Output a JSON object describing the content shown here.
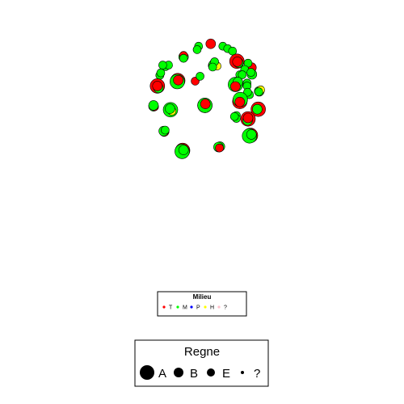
{
  "chart_data": {
    "type": "scatter",
    "title": "",
    "xlabel": "",
    "ylabel": "",
    "xlim": [
      0,
      100
    ],
    "ylim": [
      0,
      100
    ],
    "grid": false,
    "colors": {
      "T": "#ff0000",
      "M": "#00ff00",
      "P": "#0000ff",
      "H": "#ffff00",
      "?": "#ffc0cb",
      "outline": "#000000"
    },
    "size_scale": {
      "A": 9,
      "B": 6,
      "E": 5,
      "?": 2
    },
    "clusters": [
      {
        "x": 47.2,
        "y": 73.2,
        "bubbles": [
          [
            "T",
            "E",
            0,
            0
          ]
        ]
      },
      {
        "x": 49.2,
        "y": 75.2,
        "bubbles": [
          [
            "M",
            "E",
            0,
            0
          ]
        ]
      },
      {
        "x": 53.6,
        "y": 88.6,
        "bubbles": [
          [
            "T",
            "B",
            0,
            0
          ]
        ]
      },
      {
        "x": 58.6,
        "y": 87.6,
        "bubbles": [
          [
            "M",
            "E",
            0,
            0
          ]
        ]
      },
      {
        "x": 60.6,
        "y": 86.6,
        "bubbles": [
          [
            "M",
            "E",
            0,
            0
          ]
        ]
      },
      {
        "x": 62.6,
        "y": 85.6,
        "bubbles": [
          [
            "M",
            "E",
            0,
            0
          ]
        ]
      },
      {
        "x": 48.6,
        "y": 87.6,
        "bubbles": [
          [
            "M",
            "E",
            0,
            0
          ]
        ]
      },
      {
        "x": 48.0,
        "y": 86.2,
        "bubbles": [
          [
            "M",
            "E",
            0,
            0
          ]
        ]
      },
      {
        "x": 42.4,
        "y": 83.2,
        "bubbles": [
          [
            "M",
            "B",
            0,
            0
          ],
          [
            "T",
            "E",
            0,
            0.6
          ],
          [
            "M",
            "E",
            0,
            -0.6
          ]
        ]
      },
      {
        "x": 35.0,
        "y": 79.2,
        "bubbles": [
          [
            "M",
            "E",
            0,
            0
          ],
          [
            "M",
            "E",
            1.2,
            0.6
          ],
          [
            "M",
            "E",
            -1.2,
            0.6
          ]
        ]
      },
      {
        "x": 32.6,
        "y": 75.6,
        "bubbles": [
          [
            "M",
            "E",
            0,
            0
          ],
          [
            "M",
            "E",
            0.4,
            1.0
          ]
        ]
      },
      {
        "x": 54.6,
        "y": 79.6,
        "bubbles": [
          [
            "T",
            "B",
            0,
            0
          ],
          [
            "M",
            "B",
            0.2,
            0.4
          ],
          [
            "H",
            "E",
            1.6,
            -0.2
          ],
          [
            "M",
            "E",
            0.6,
            1.6
          ],
          [
            "M",
            "E",
            -0.2,
            -0.6
          ]
        ]
      },
      {
        "x": 64.4,
        "y": 81.4,
        "bubbles": [
          [
            "T",
            "A",
            0,
            0
          ],
          [
            "M",
            "B",
            0.6,
            -0.6
          ],
          [
            "T",
            "B",
            0.2,
            -0.2
          ]
        ]
      },
      {
        "x": 70.4,
        "y": 78.8,
        "bubbles": [
          [
            "T",
            "B",
            0,
            0
          ]
        ]
      },
      {
        "x": 69.0,
        "y": 80.6,
        "bubbles": [
          [
            "M",
            "E",
            0,
            0
          ]
        ]
      },
      {
        "x": 67.6,
        "y": 78.0,
        "bubbles": [
          [
            "M",
            "E",
            0,
            0
          ]
        ]
      },
      {
        "x": 70.6,
        "y": 76.0,
        "bubbles": [
          [
            "M",
            "B",
            0,
            0
          ],
          [
            "M",
            "E",
            -0.4,
            0.8
          ]
        ]
      },
      {
        "x": 65.6,
        "y": 75.8,
        "bubbles": [
          [
            "M",
            "E",
            0,
            0
          ],
          [
            "M",
            "E",
            1.0,
            0
          ]
        ]
      },
      {
        "x": 40.0,
        "y": 73.4,
        "bubbles": [
          [
            "T",
            "A",
            0,
            0
          ],
          [
            "M",
            "A",
            -0.2,
            -0.4
          ],
          [
            "T",
            "B",
            0.2,
            0.2
          ]
        ]
      },
      {
        "x": 31.6,
        "y": 71.2,
        "bubbles": [
          [
            "T",
            "A",
            0,
            0
          ],
          [
            "M",
            "B",
            0.4,
            -0.8
          ],
          [
            "T",
            "B",
            0,
            0
          ]
        ]
      },
      {
        "x": 63.8,
        "y": 71.8,
        "bubbles": [
          [
            "M",
            "A",
            0,
            0
          ],
          [
            "M",
            "B",
            1.0,
            1.0
          ],
          [
            "T",
            "B",
            0,
            -0.8
          ]
        ]
      },
      {
        "x": 68.6,
        "y": 72.4,
        "bubbles": [
          [
            "M",
            "E",
            0,
            0
          ],
          [
            "M",
            "E",
            0,
            -1.2
          ]
        ]
      },
      {
        "x": 69.6,
        "y": 67.6,
        "bubbles": [
          [
            "M",
            "E",
            0,
            0
          ],
          [
            "M",
            "E",
            -0.8,
            1.0
          ]
        ]
      },
      {
        "x": 73.6,
        "y": 69.0,
        "bubbles": [
          [
            "M",
            "B",
            0,
            0
          ],
          [
            "H",
            "E",
            0.6,
            0.6
          ],
          [
            "M",
            "E",
            -0.2,
            -0.2
          ]
        ]
      },
      {
        "x": 51.2,
        "y": 63.2,
        "bubbles": [
          [
            "T",
            "A",
            0,
            0
          ],
          [
            "M",
            "A",
            0,
            0
          ],
          [
            "T",
            "B",
            0.2,
            0.6
          ]
        ]
      },
      {
        "x": 65.6,
        "y": 64.8,
        "bubbles": [
          [
            "T",
            "A",
            0,
            0
          ],
          [
            "M",
            "A",
            0.2,
            0.8
          ],
          [
            "T",
            "B",
            0,
            -0.2
          ]
        ]
      },
      {
        "x": 30.0,
        "y": 62.8,
        "bubbles": [
          [
            "M",
            "B",
            0,
            0
          ],
          [
            "T",
            "E",
            0.4,
            -0.2
          ],
          [
            "M",
            "B",
            0,
            0.4
          ]
        ]
      },
      {
        "x": 37.0,
        "y": 61.4,
        "bubbles": [
          [
            "M",
            "A",
            0,
            0
          ],
          [
            "H",
            "E",
            0.6,
            -0.6
          ],
          [
            "M",
            "B",
            -0.2,
            0.4
          ]
        ]
      },
      {
        "x": 73.2,
        "y": 61.6,
        "bubbles": [
          [
            "T",
            "A",
            0,
            0
          ],
          [
            "M",
            "B",
            -0.4,
            0
          ]
        ]
      },
      {
        "x": 64.2,
        "y": 59.0,
        "bubbles": [
          [
            "M",
            "E",
            0,
            0
          ],
          [
            "M",
            "E",
            0,
            -1.2
          ],
          [
            "M",
            "E",
            -0.8,
            -0.4
          ]
        ]
      },
      {
        "x": 69.0,
        "y": 57.6,
        "bubbles": [
          [
            "T",
            "A",
            0,
            0
          ],
          [
            "M",
            "B",
            -0.2,
            -0.6
          ],
          [
            "T",
            "B",
            0,
            0.4
          ]
        ]
      },
      {
        "x": 70.0,
        "y": 50.8,
        "bubbles": [
          [
            "T",
            "A",
            0,
            0
          ],
          [
            "M",
            "A",
            -0.4,
            -0.2
          ],
          [
            "M",
            "B",
            0.4,
            0.4
          ]
        ]
      },
      {
        "x": 34.4,
        "y": 52.4,
        "bubbles": [
          [
            "T",
            "B",
            0,
            0
          ],
          [
            "M",
            "B",
            -0.2,
            0.2
          ],
          [
            "M",
            "E",
            0.4,
            0.6
          ]
        ]
      },
      {
        "x": 42.0,
        "y": 44.6,
        "bubbles": [
          [
            "T",
            "A",
            0,
            0
          ],
          [
            "M",
            "A",
            -0.2,
            -0.4
          ],
          [
            "M",
            "B",
            0.4,
            0.2
          ]
        ]
      },
      {
        "x": 57.4,
        "y": 46.2,
        "bubbles": [
          [
            "M",
            "B",
            0,
            0
          ],
          [
            "M",
            "B",
            -0.6,
            -0.2
          ],
          [
            "T",
            "E",
            -0.2,
            -0.6
          ]
        ]
      }
    ],
    "legends": [
      {
        "title": "Milieu",
        "entries": [
          {
            "label": "T",
            "color": "#ff0000"
          },
          {
            "label": "M",
            "color": "#00ff00"
          },
          {
            "label": "P",
            "color": "#0000ff"
          },
          {
            "label": "H",
            "color": "#ffff00"
          },
          {
            "label": "?",
            "color": "#ffc0cb"
          }
        ]
      },
      {
        "title": "Regne",
        "entries": [
          {
            "label": "A",
            "size": "A"
          },
          {
            "label": "B",
            "size": "B"
          },
          {
            "label": "E",
            "size": "E"
          },
          {
            "label": "?",
            "size": "?"
          }
        ]
      }
    ]
  }
}
